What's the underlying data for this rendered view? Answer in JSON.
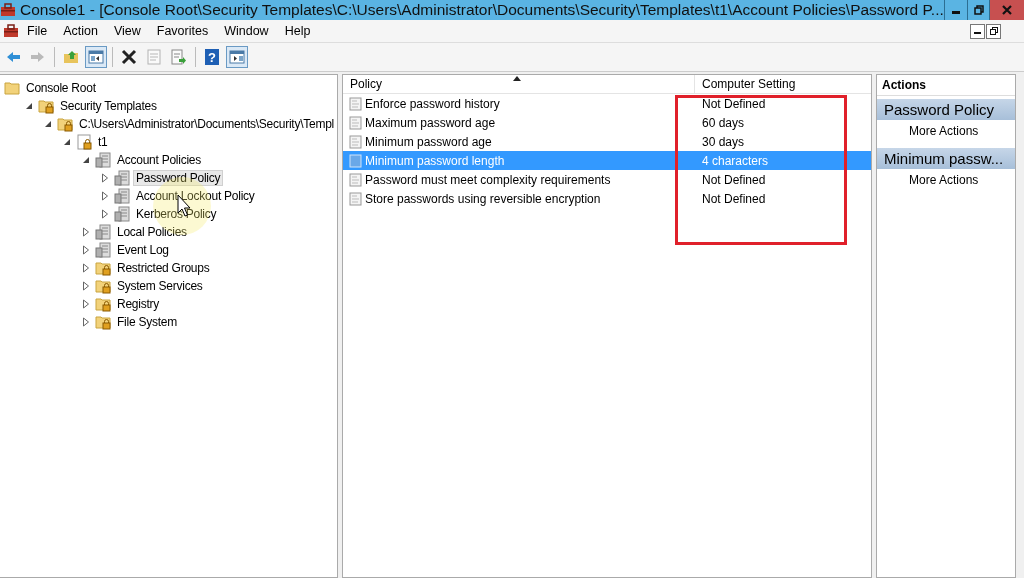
{
  "window": {
    "title": "Console1 - [Console Root\\Security Templates\\C:\\Users\\Administrator\\Documents\\Security\\Templates\\t1\\Account Policies\\Password P..."
  },
  "menu": [
    "File",
    "Action",
    "View",
    "Favorites",
    "Window",
    "Help"
  ],
  "toolbar": [
    {
      "kind": "back",
      "pressed": false,
      "disabled": false
    },
    {
      "kind": "forward",
      "pressed": false,
      "disabled": true
    },
    {
      "kind": "sep"
    },
    {
      "kind": "up",
      "pressed": false,
      "disabled": false
    },
    {
      "kind": "tree",
      "pressed": true,
      "disabled": false
    },
    {
      "kind": "sep"
    },
    {
      "kind": "delete",
      "pressed": false,
      "disabled": false
    },
    {
      "kind": "properties",
      "pressed": false,
      "disabled": true
    },
    {
      "kind": "export",
      "pressed": false,
      "disabled": false
    },
    {
      "kind": "sep"
    },
    {
      "kind": "help",
      "pressed": false,
      "disabled": false,
      "glyph": "?"
    },
    {
      "kind": "actionpane",
      "pressed": true,
      "disabled": false
    }
  ],
  "tree": [
    {
      "label": "Console Root",
      "kind": "folder",
      "selected": false,
      "children": [
        {
          "label": "Security Templates",
          "kind": "lockfolder",
          "expanded": true,
          "selected": false,
          "children": [
            {
              "label": "C:\\Users\\Administrator\\Documents\\Security\\Templ",
              "kind": "lockfolder",
              "expanded": true,
              "selected": false,
              "children": [
                {
                  "label": "t1",
                  "kind": "template",
                  "expanded": true,
                  "selected": false,
                  "children": [
                    {
                      "label": "Account Policies",
                      "kind": "policy",
                      "expanded": true,
                      "selected": false,
                      "children": [
                        {
                          "label": "Password Policy",
                          "kind": "policy",
                          "expanded": false,
                          "selected": true
                        },
                        {
                          "label": "Account Lockout Policy",
                          "kind": "policy",
                          "expanded": false,
                          "selected": false
                        },
                        {
                          "label": "Kerberos Policy",
                          "kind": "policy",
                          "expanded": false,
                          "selected": false
                        }
                      ]
                    },
                    {
                      "label": "Local Policies",
                      "kind": "policy",
                      "expanded": false,
                      "selected": false
                    },
                    {
                      "label": "Event Log",
                      "kind": "policy",
                      "expanded": false,
                      "selected": false
                    },
                    {
                      "label": "Restricted Groups",
                      "kind": "lockfolder",
                      "expanded": false,
                      "selected": false
                    },
                    {
                      "label": "System Services",
                      "kind": "lockfolder",
                      "expanded": false,
                      "selected": false
                    },
                    {
                      "label": "Registry",
                      "kind": "lockfolder",
                      "expanded": false,
                      "selected": false
                    },
                    {
                      "label": "File System",
                      "kind": "lockfolder",
                      "expanded": false,
                      "selected": false
                    }
                  ]
                }
              ]
            }
          ]
        }
      ]
    }
  ],
  "table": {
    "columns": [
      "Policy",
      "Computer Setting"
    ],
    "rows": [
      {
        "policy": "Enforce password history",
        "setting": "Not Defined",
        "selected": false
      },
      {
        "policy": "Maximum password age",
        "setting": "60 days",
        "selected": false
      },
      {
        "policy": "Minimum password age",
        "setting": "30 days",
        "selected": false
      },
      {
        "policy": "Minimum password length",
        "setting": "4 characters",
        "selected": true
      },
      {
        "policy": "Password must meet complexity requirements",
        "setting": "Not Defined",
        "selected": false
      },
      {
        "policy": "Store passwords using reversible encryption",
        "setting": "Not Defined",
        "selected": false
      }
    ]
  },
  "actions": {
    "title": "Actions",
    "sections": [
      {
        "header": "Password Policy",
        "items": [
          "More Actions"
        ]
      },
      {
        "header": "Minimum passw...",
        "items": [
          "More Actions"
        ]
      }
    ]
  }
}
